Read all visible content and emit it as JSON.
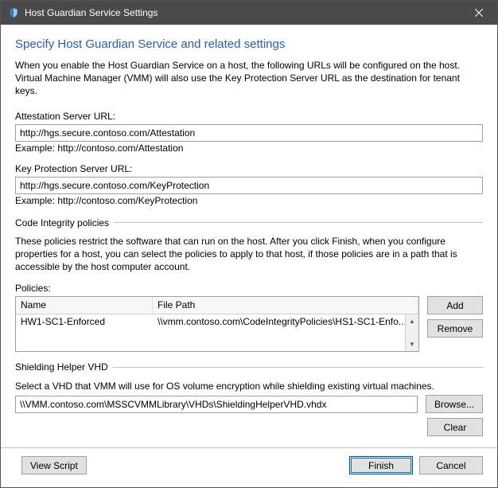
{
  "window": {
    "title": "Host Guardian Service Settings",
    "close_tip": "Close"
  },
  "heading": "Specify Host Guardian Service and related settings",
  "intro": "When you enable the Host Guardian Service on a host, the following URLs will be configured on the host. Virtual Machine Manager (VMM) will also use the Key Protection Server URL as the destination for tenant keys.",
  "attest": {
    "label": "Attestation Server URL:",
    "value": "http://hgs.secure.contoso.com/Attestation",
    "hint": "Example: http://contoso.com/Attestation"
  },
  "keyprot": {
    "label": "Key Protection Server URL:",
    "value": "http://hgs.secure.contoso.com/KeyProtection",
    "hint": "Example: http://contoso.com/KeyProtection"
  },
  "ci": {
    "group": "Code Integrity policies",
    "text": "These policies restrict the software that can run on the host. After you click Finish, when you configure properties for a host, you can select the policies to apply to that host, if those policies are in a path that is accessible by the host computer account.",
    "list_label": "Policies:",
    "cols": {
      "name": "Name",
      "path": "File Path"
    },
    "rows": [
      {
        "name": "HW1-SC1-Enforced",
        "path": "\\\\vmm.contoso.com\\CodeIntegrityPolicies\\HS1-SC1-Enfo..."
      }
    ],
    "add": "Add",
    "remove": "Remove"
  },
  "vhd": {
    "group": "Shielding Helper VHD",
    "text": "Select a VHD that VMM will use for OS volume encryption while shielding existing virtual machines.",
    "value": "\\\\VMM.contoso.com\\MSSCVMMLibrary\\VHDs\\ShieldingHelperVHD.vhdx",
    "browse": "Browse...",
    "clear": "Clear"
  },
  "buttons": {
    "view_script": "View Script",
    "finish": "Finish",
    "cancel": "Cancel"
  }
}
